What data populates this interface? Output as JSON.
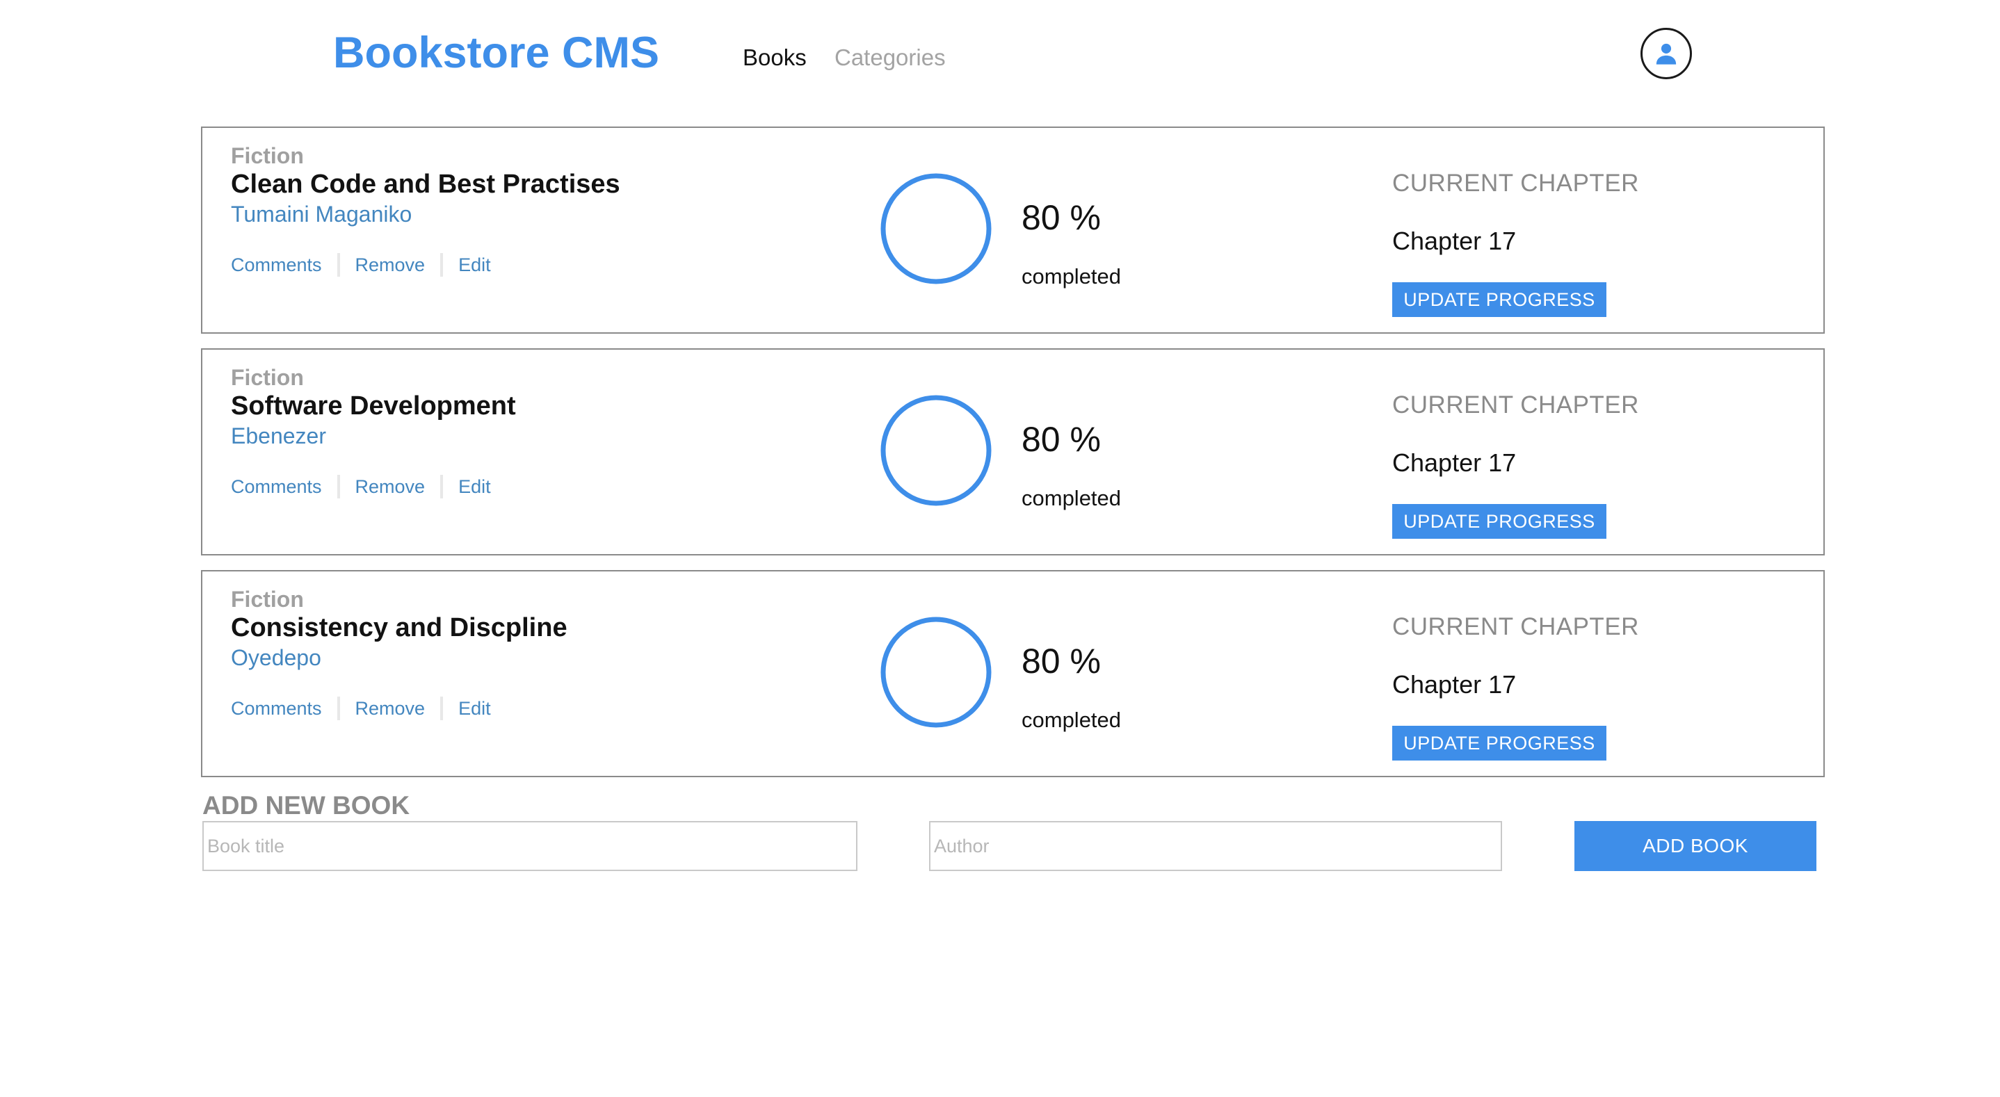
{
  "header": {
    "logo": "Bookstore CMS",
    "nav": [
      {
        "label": "Books"
      },
      {
        "label": "Categories"
      }
    ],
    "avatar_icon": "user-icon"
  },
  "colors": {
    "accent": "#3e8ee9",
    "link": "#4386bf",
    "muted": "#a0a0a0"
  },
  "books": [
    {
      "genre": "Fiction",
      "title": "Clean Code and Best Practises",
      "author": "Tumaini Maganiko",
      "actions": [
        "Comments",
        "Remove",
        "Edit"
      ],
      "progress_percent": "80 %",
      "progress_value": 0.8,
      "progress_label": "completed",
      "chapter_label": "CURRENT CHAPTER",
      "chapter": "Chapter 17",
      "update_label": "UPDATE PROGRESS"
    },
    {
      "genre": "Fiction",
      "title": "Software Development",
      "author": "Ebenezer",
      "actions": [
        "Comments",
        "Remove",
        "Edit"
      ],
      "progress_percent": "80 %",
      "progress_value": 0.8,
      "progress_label": "completed",
      "chapter_label": "CURRENT CHAPTER",
      "chapter": "Chapter 17",
      "update_label": "UPDATE PROGRESS"
    },
    {
      "genre": "Fiction",
      "title": "Consistency and Discpline",
      "author": "Oyedepo",
      "actions": [
        "Comments",
        "Remove",
        "Edit"
      ],
      "progress_percent": "80 %",
      "progress_value": 0.8,
      "progress_label": "completed",
      "chapter_label": "CURRENT CHAPTER",
      "chapter": "Chapter 17",
      "update_label": "UPDATE PROGRESS"
    }
  ],
  "form": {
    "title": "ADD NEW BOOK",
    "title_placeholder": "Book title",
    "title_value": "",
    "author_placeholder": "Author",
    "author_value": "",
    "submit_label": "ADD BOOK"
  }
}
